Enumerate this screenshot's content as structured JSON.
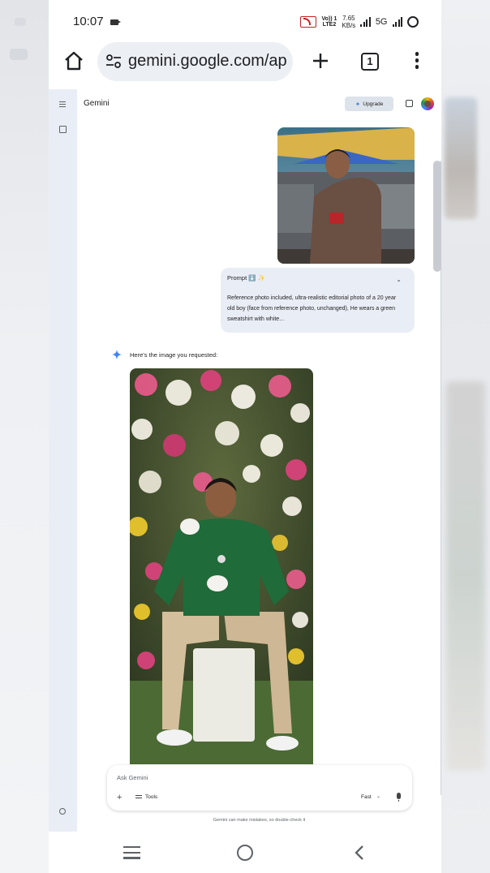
{
  "status_bar": {
    "time": "10:07",
    "volte": "Vo)) 1\nLTE2",
    "volte_line1": "Vo)) 1",
    "volte_line2": "LTE2",
    "speed_value": "7.65",
    "speed_unit": "KB/s",
    "network": "5G"
  },
  "browser": {
    "url": "gemini.google.com/ap",
    "tab_count": "1"
  },
  "gemini": {
    "title": "Gemini",
    "upgrade_label": "Upgrade",
    "prompt_card": {
      "title": "Prompt ⬇️ ✨",
      "body": "Reference photo included, ultra-realistic editorial photo of a 20 year old boy (face from reference photo, unchanged), He wears a green sweatshirt with white..."
    },
    "reply": "Here's the image you requested:",
    "input": {
      "placeholder": "Ask Gemini",
      "tools_label": "Tools",
      "mode_label": "Fast"
    },
    "disclaimer": "Gemini can make mistakes, so double-check it"
  },
  "colors": {
    "accent": "#4285f4",
    "rail_bg": "#e9eef6",
    "hotspot": "#c5221f",
    "sweatshirt": "#1f6b3a"
  },
  "icons": [
    "home-icon",
    "tune-icon",
    "plus-icon",
    "menu-dots-icon",
    "sidebar-menu-icon",
    "new-chat-icon",
    "settings-gear-icon",
    "spark-icon",
    "bag-icon",
    "mic-icon",
    "nav-menu-icon",
    "nav-home-icon",
    "nav-back-icon"
  ]
}
